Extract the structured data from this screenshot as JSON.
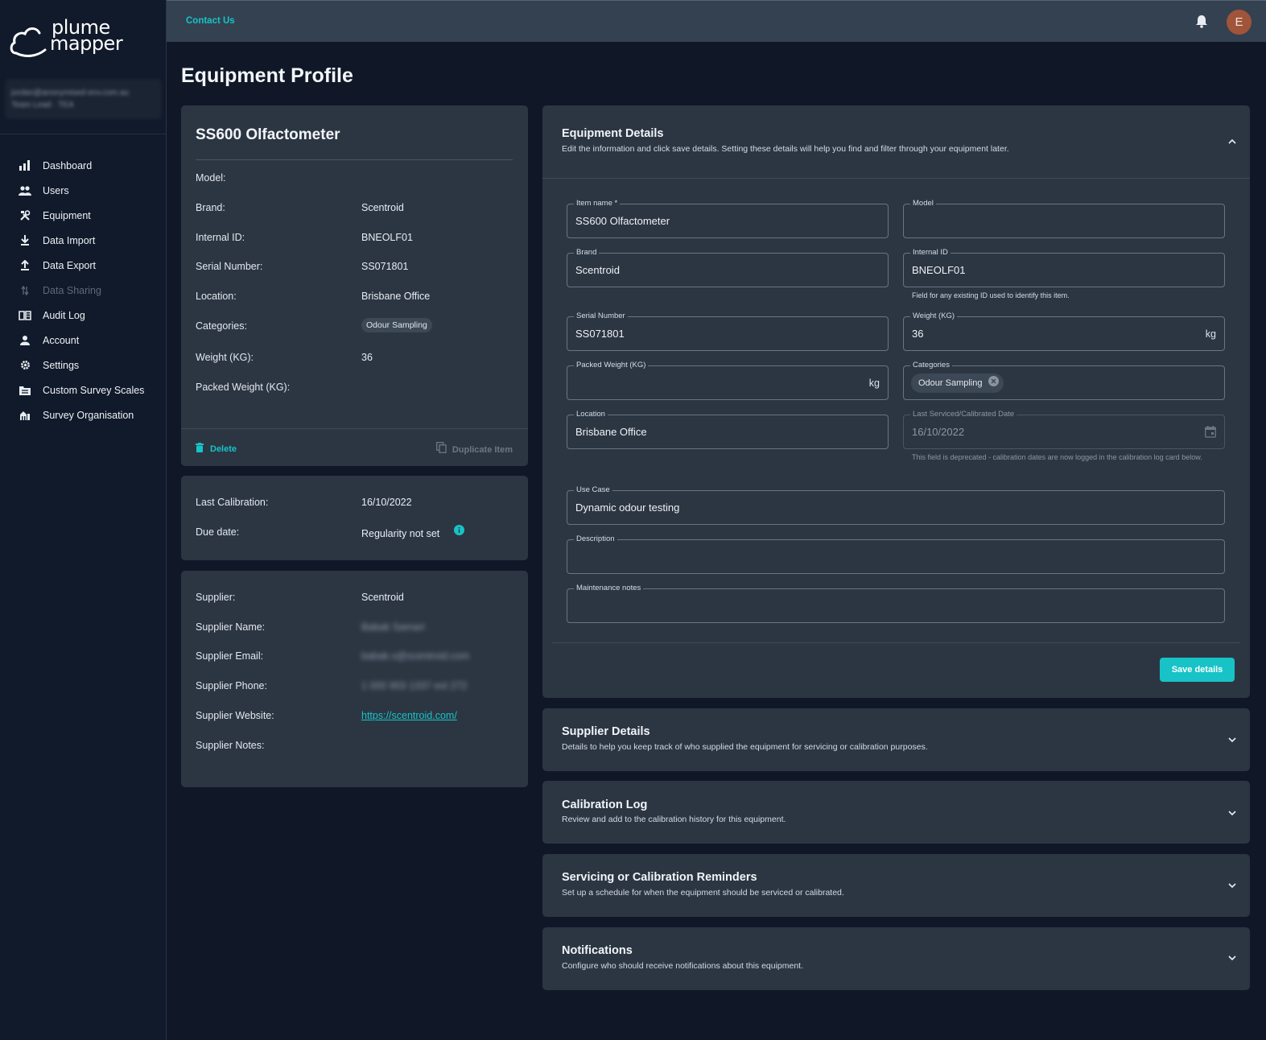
{
  "brand": {
    "line1": "plume",
    "line2": "mapper"
  },
  "user": {
    "email": "jordan@anonymised-env.com.au",
    "role": "Team Lead · TEA"
  },
  "sidebar": {
    "items": [
      {
        "label": "Dashboard",
        "icon": "bar-chart-icon"
      },
      {
        "label": "Users",
        "icon": "users-icon"
      },
      {
        "label": "Equipment",
        "icon": "tools-icon"
      },
      {
        "label": "Data Import",
        "icon": "download-icon"
      },
      {
        "label": "Data Export",
        "icon": "upload-icon"
      },
      {
        "label": "Data Sharing",
        "icon": "swap-icon"
      },
      {
        "label": "Audit Log",
        "icon": "book-icon"
      },
      {
        "label": "Account",
        "icon": "person-icon"
      },
      {
        "label": "Settings",
        "icon": "gear-icon"
      },
      {
        "label": "Custom Survey Scales",
        "icon": "folder-list-icon"
      },
      {
        "label": "Survey Organisation",
        "icon": "organisation-icon"
      }
    ]
  },
  "topbar": {
    "contact_label": "Contact Us",
    "avatar_initial": "E"
  },
  "page": {
    "title": "Equipment Profile"
  },
  "summary": {
    "name": "SS600 Olfactometer",
    "rows": [
      {
        "label": "Model:",
        "value": ""
      },
      {
        "label": "Brand:",
        "value": "Scentroid"
      },
      {
        "label": "Internal ID:",
        "value": "BNEOLF01"
      },
      {
        "label": "Serial Number:",
        "value": "SS071801"
      },
      {
        "label": "Location:",
        "value": "Brisbane Office"
      },
      {
        "label": "Categories:",
        "value": "Odour Sampling"
      },
      {
        "label": "Weight (KG):",
        "value": "36"
      },
      {
        "label": "Packed Weight (KG):",
        "value": ""
      }
    ],
    "delete_label": "Delete",
    "duplicate_label": "Duplicate Item"
  },
  "calibration": {
    "last_label": "Last Calibration:",
    "last_value": "16/10/2022",
    "due_label": "Due date:",
    "due_value": "Regularity not set"
  },
  "supplier": {
    "rows": [
      {
        "label": "Supplier:",
        "value": "Scentroid"
      },
      {
        "label": "Supplier Name:",
        "value": "Babak Samari"
      },
      {
        "label": "Supplier Email:",
        "value": "babak.s@scentroid.com"
      },
      {
        "label": "Supplier Phone:",
        "value": "1 000 903 1337 ext 272"
      },
      {
        "label": "Supplier Website:",
        "value": "https://scentroid.com/"
      },
      {
        "label": "Supplier Notes:",
        "value": ""
      }
    ]
  },
  "details": {
    "title": "Equipment Details",
    "subtitle": "Edit the information and click save details. Setting these details will help you find and filter through your equipment later.",
    "fields": {
      "item_name": {
        "label": "Item name *",
        "value": "SS600 Olfactometer"
      },
      "model": {
        "label": "Model",
        "value": ""
      },
      "brand": {
        "label": "Brand",
        "value": "Scentroid"
      },
      "internal_id": {
        "label": "Internal ID",
        "value": "BNEOLF01",
        "helper": "Field for any existing ID used to identify this item."
      },
      "serial": {
        "label": "Serial Number",
        "value": "SS071801"
      },
      "weight": {
        "label": "Weight (KG)",
        "value": "36",
        "suffix": "kg"
      },
      "packed_weight": {
        "label": "Packed Weight (KG)",
        "value": "",
        "suffix": "kg"
      },
      "categories": {
        "label": "Categories",
        "chip": "Odour Sampling"
      },
      "location": {
        "label": "Location",
        "value": "Brisbane Office"
      },
      "last_serviced": {
        "label": "Last Serviced/Calibrated Date",
        "value": "16/10/2022",
        "helper": "This field is deprecated - calibration dates are now logged in the calibration log card below."
      },
      "use_case": {
        "label": "Use Case",
        "value": "Dynamic odour testing"
      },
      "description": {
        "label": "Description",
        "value": ""
      },
      "maintenance": {
        "label": "Maintenance notes",
        "value": ""
      }
    },
    "save_label": "Save details"
  },
  "panels": [
    {
      "title": "Supplier Details",
      "subtitle": "Details to help you keep track of who supplied the equipment for servicing or calibration purposes."
    },
    {
      "title": "Calibration Log",
      "subtitle": "Review and add to the calibration history for this equipment."
    },
    {
      "title": "Servicing or Calibration Reminders",
      "subtitle": "Set up a schedule for when the equipment should be serviced or calibrated."
    },
    {
      "title": "Notifications",
      "subtitle": "Configure who should receive notifications about this equipment."
    }
  ],
  "colors": {
    "accent": "#17c3c6",
    "background": "#101828",
    "card": "#2c3643",
    "topbar": "#344150"
  }
}
